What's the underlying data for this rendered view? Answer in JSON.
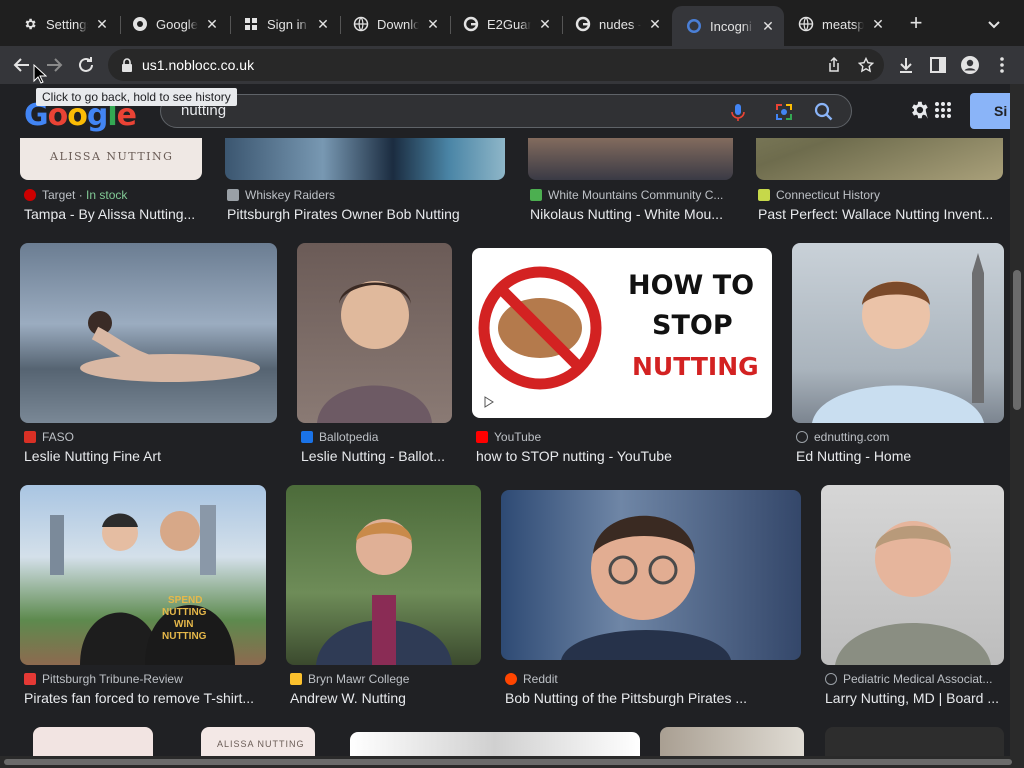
{
  "tabs": [
    {
      "title": "Settings",
      "favicon": "gear-icon"
    },
    {
      "title": "Google",
      "favicon": "chrome-icon"
    },
    {
      "title": "Sign in",
      "favicon": "grid-icon"
    },
    {
      "title": "Downlo",
      "favicon": "globe-icon"
    },
    {
      "title": "E2Guar",
      "favicon": "google-icon"
    },
    {
      "title": "nudes -",
      "favicon": "google-icon"
    },
    {
      "title": "Incogni",
      "favicon": "incognito-icon",
      "active": true
    },
    {
      "title": "meatsp",
      "favicon": "globe-icon"
    }
  ],
  "toolbar": {
    "url": "us1.noblocc.co.uk",
    "back_tooltip": "Click to go back, hold to see history"
  },
  "google": {
    "logo": "Google",
    "query": "nutting",
    "signin_label": "Si"
  },
  "results": [
    {
      "source": "Target",
      "stock": "In stock",
      "caption": "Tampa - By Alissa Nutting...",
      "img_text": "ALISSA NUTTING",
      "icon_color": "#cc0000"
    },
    {
      "source": "Whiskey Raiders",
      "caption": "Pittsburgh Pirates Owner Bob Nutting",
      "icon_color": "#9aa0a6"
    },
    {
      "source": "White Mountains Community C...",
      "caption": "Nikolaus Nutting - White Mou...",
      "icon_color": "#4caf50"
    },
    {
      "source": "Connecticut History",
      "caption": "Past Perfect: Wallace Nutting Invent...",
      "icon_color": "#c6d84a"
    },
    {
      "source": "FASO",
      "caption": "Leslie Nutting Fine Art",
      "icon_color": "#d93025"
    },
    {
      "source": "Ballotpedia",
      "caption": "Leslie Nutting - Ballot...",
      "icon_color": "#1a73e8"
    },
    {
      "source": "YouTube",
      "caption": "how to STOP nutting - YouTube",
      "img_text": [
        "HOW TO",
        "STOP",
        "NUTTING"
      ],
      "icon_color": "#ff0000"
    },
    {
      "source": "ednutting.com",
      "caption": "Ed Nutting - Home",
      "icon_color": "#9aa0a6"
    },
    {
      "source": "Pittsburgh Tribune-Review",
      "caption": "Pirates fan forced to remove T-shirt...",
      "img_text": [
        "SPEND",
        "NUTTING",
        "WIN",
        "NUTTING"
      ],
      "icon_color": "#e53935"
    },
    {
      "source": "Bryn Mawr College",
      "caption": "Andrew W. Nutting",
      "icon_color": "#fbc02d"
    },
    {
      "source": "Reddit",
      "caption": "Bob Nutting of the Pittsburgh Pirates ...",
      "icon_color": "#ff4500"
    },
    {
      "source": "Pediatric Medical Associat...",
      "caption": "Larry Nutting, MD | Board ...",
      "icon_color": "#9aa0a6"
    },
    {
      "img_text": "ALISSA NUTTING"
    }
  ]
}
